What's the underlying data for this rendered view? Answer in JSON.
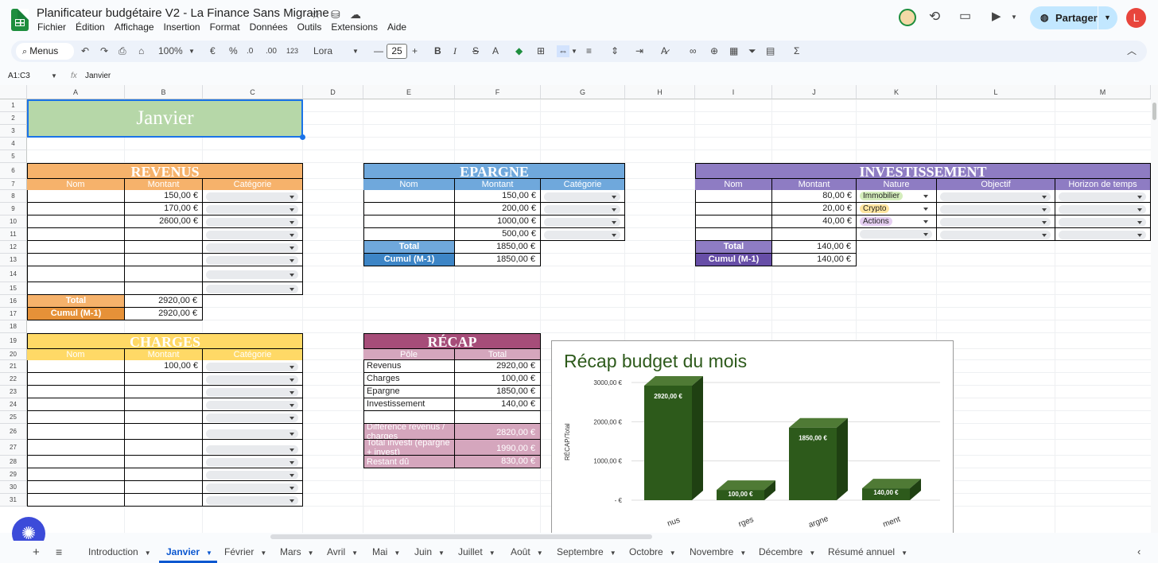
{
  "header": {
    "doc_title": "Planificateur budgétaire V2 - La Finance Sans Migraine",
    "share_label": "Partager",
    "avatar_letter": "L",
    "menu": [
      "Fichier",
      "Édition",
      "Affichage",
      "Insertion",
      "Format",
      "Données",
      "Outils",
      "Extensions",
      "Aide"
    ]
  },
  "toolbar": {
    "menus_label": "Menus",
    "zoom": "100%",
    "currency": "€",
    "percent": "%",
    "dec_less": ".0",
    "dec_more": ".00",
    "format_123": "123",
    "font": "Lora",
    "font_size": "25"
  },
  "formula": {
    "name_box": "A1:C3",
    "content": "Janvier"
  },
  "columns": [
    "A",
    "B",
    "C",
    "D",
    "E",
    "F",
    "G",
    "H",
    "I",
    "J",
    "K",
    "L",
    "M"
  ],
  "month_title": "Janvier",
  "revenus": {
    "title": "REVENUS",
    "headers": [
      "Nom",
      "Montant",
      "Catégorie"
    ],
    "amounts": [
      "150,00  €",
      "170,00  €",
      "2600,00  €"
    ],
    "total_label": "Total",
    "total": "2920,00  €",
    "cumul_label": "Cumul (M-1)",
    "cumul": "2920,00  €"
  },
  "charges": {
    "title": "CHARGES",
    "headers": [
      "Nom",
      "Montant",
      "Catégorie"
    ],
    "amounts": [
      "100,00  €"
    ]
  },
  "epargne": {
    "title": "EPARGNE",
    "headers": [
      "Nom",
      "Montant",
      "Catégorie"
    ],
    "amounts": [
      "150,00  €",
      "200,00  €",
      "1000,00  €",
      "500,00  €"
    ],
    "total_label": "Total",
    "total": "1850,00  €",
    "cumul_label": "Cumul (M-1)",
    "cumul": "1850,00  €"
  },
  "investissement": {
    "title": "INVESTISSEMENT",
    "headers": [
      "Nom",
      "Montant",
      "Nature",
      "Objectif",
      "Horizon de temps"
    ],
    "amounts": [
      "80,00  €",
      "20,00  €",
      "40,00  €"
    ],
    "natures": [
      "Immobilier",
      "Crypto",
      "Actions"
    ],
    "total_label": "Total",
    "total": "140,00  €",
    "cumul_label": "Cumul (M-1)",
    "cumul": "140,00  €"
  },
  "recap": {
    "title": "RÉCAP",
    "headers": [
      "Pôle",
      "Total"
    ],
    "rows": [
      {
        "label": "Revenus",
        "value": "2920,00  €"
      },
      {
        "label": "Charges",
        "value": "100,00  €"
      },
      {
        "label": "Epargne",
        "value": "1850,00  €"
      },
      {
        "label": "Investissement",
        "value": "140,00  €"
      }
    ],
    "diff_label": "Différence revenus / charges",
    "diff": "2820,00  €",
    "invest_label": "Total investi (épargne + invest)",
    "invest": "1990,00  €",
    "restant_label": "Restant dû",
    "restant": "830,00  €"
  },
  "chart_data": {
    "type": "bar",
    "title": "Récap budget du mois",
    "ylabel": "RÉCAP/Total",
    "xlabel": "",
    "categories": [
      "Revenus",
      "Charges",
      "Epargne",
      "Investissement"
    ],
    "tick_labels": [
      "nus",
      "rges",
      "argne",
      "ment"
    ],
    "values": [
      2920,
      100,
      1850,
      140
    ],
    "data_labels": [
      "2920,00 €",
      "100,00 €",
      "1850,00 €",
      "140,00 €"
    ],
    "yticks": [
      {
        "v": 3000,
        "label": "3000,00 €"
      },
      {
        "v": 2000,
        "label": "2000,00 €"
      },
      {
        "v": 1000,
        "label": "1000,00 €"
      },
      {
        "v": 0,
        "label": "- €"
      }
    ],
    "ylim": [
      0,
      3000
    ],
    "grid": true,
    "color": "#2d5a1b"
  },
  "tabs": [
    "Introduction",
    "Janvier",
    "Février",
    "Mars",
    "Avril",
    "Mai",
    "Juin",
    "Juillet",
    "Août",
    "Septembre",
    "Octobre",
    "Novembre",
    "Décembre",
    "Résumé annuel"
  ],
  "active_tab": "Janvier",
  "colors": {
    "revenus": "#f6b26b",
    "revenus_dark": "#e69138",
    "epargne": "#6fa8dc",
    "epargne_dark": "#3d85c6",
    "invest": "#8e7cc3",
    "invest_dark": "#674ea7",
    "charges": "#ffd966",
    "recap": "#a64d79",
    "recap_light": "#d5a6bd",
    "month": "#b6d7a8",
    "accent": "#1e8e3e"
  }
}
